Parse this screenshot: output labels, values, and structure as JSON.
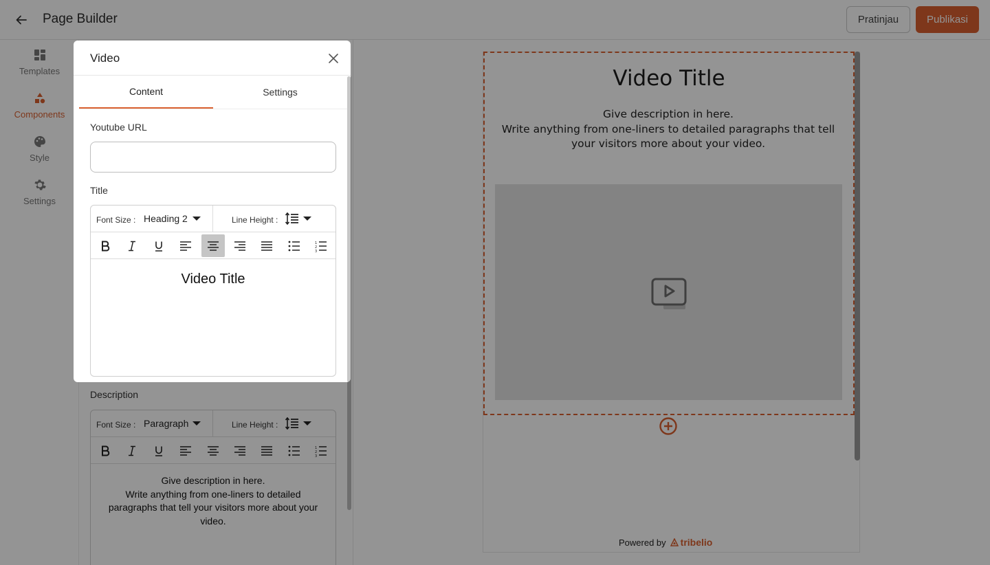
{
  "header": {
    "title": "Page Builder",
    "preview_label": "Pratinjau",
    "publish_label": "Publikasi"
  },
  "sidebar": {
    "items": [
      {
        "label": "Templates",
        "icon": "grid-icon"
      },
      {
        "label": "Components",
        "icon": "shapes-icon",
        "active": true
      },
      {
        "label": "Style",
        "icon": "palette-icon"
      },
      {
        "label": "Settings",
        "icon": "gear-icon"
      }
    ]
  },
  "modal": {
    "title": "Video",
    "tabs": [
      {
        "label": "Content",
        "active": true
      },
      {
        "label": "Settings"
      }
    ],
    "youtube_label": "Youtube URL",
    "youtube_value": "",
    "title_label": "Title",
    "title_editor": {
      "font_size_label": "Font Size :",
      "font_size_value": "Heading 2",
      "line_height_label": "Line Height :",
      "content": "Video Title"
    }
  },
  "description_editor": {
    "label": "Description",
    "font_size_label": "Font Size :",
    "font_size_value": "Paragraph",
    "line_height_label": "Line Height :",
    "content": "Give description in here.\nWrite anything from one-liners to detailed paragraphs that tell your visitors more about your video."
  },
  "preview": {
    "title": "Video Title",
    "description_line1": "Give description in here.",
    "description_line2": "Write anything from one-liners to detailed paragraphs that tell your visitors more about your video.",
    "powered_by": "Powered by",
    "brand": "tribelio"
  },
  "colors": {
    "accent": "#d9602f",
    "overlay": "rgba(0,0,0,0.42)"
  }
}
